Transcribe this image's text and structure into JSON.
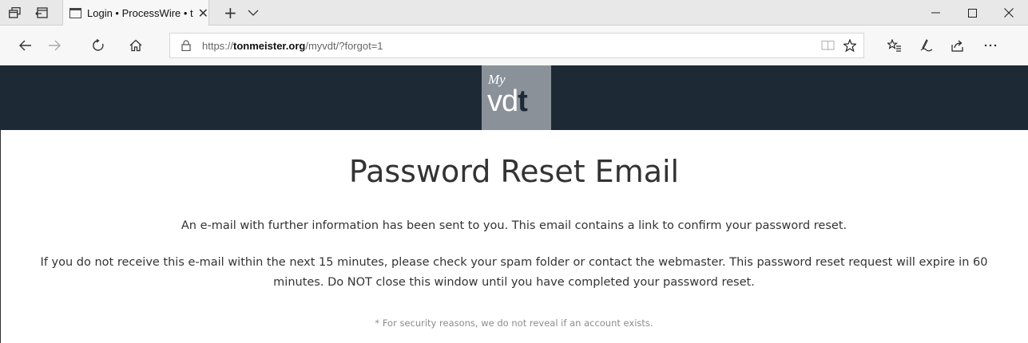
{
  "browser": {
    "tab": {
      "title": "Login • ProcessWire • tonmeister.org"
    },
    "new_tab_symbol": "+",
    "address": {
      "scheme": "https://",
      "domain": "tonmeister.org",
      "path": "/myvdt/?forgot=1"
    },
    "icons": [
      "tab-preview-icon",
      "set-aside-tabs-icon",
      "page-icon",
      "close-tab-icon",
      "new-tab-icon",
      "tab-list-chevron-icon",
      "minimize-icon",
      "maximize-icon",
      "close-window-icon",
      "back-icon",
      "forward-icon",
      "refresh-icon",
      "home-icon",
      "lock-icon",
      "reading-view-icon",
      "favorite-star-icon",
      "favorites-list-icon",
      "pen-icon",
      "share-icon",
      "more-icon"
    ]
  },
  "site": {
    "logo": {
      "script": "My",
      "letters": "vd",
      "bold_letter": "t"
    },
    "colors": {
      "header_bg": "#1e2936",
      "logo_bg": "#8a9199"
    }
  },
  "main": {
    "title": "Password Reset Email",
    "paragraph1": "An e-mail with further information has been sent to you. This email contains a link to confirm your password reset.",
    "paragraph2": "If you do not receive this e-mail within the next 15 minutes, please check your spam folder or contact the webmaster. This password reset request will expire in 60 minutes. Do NOT close this window until you have completed your password reset.",
    "note": "* For security reasons, we do not reveal if an account exists."
  }
}
